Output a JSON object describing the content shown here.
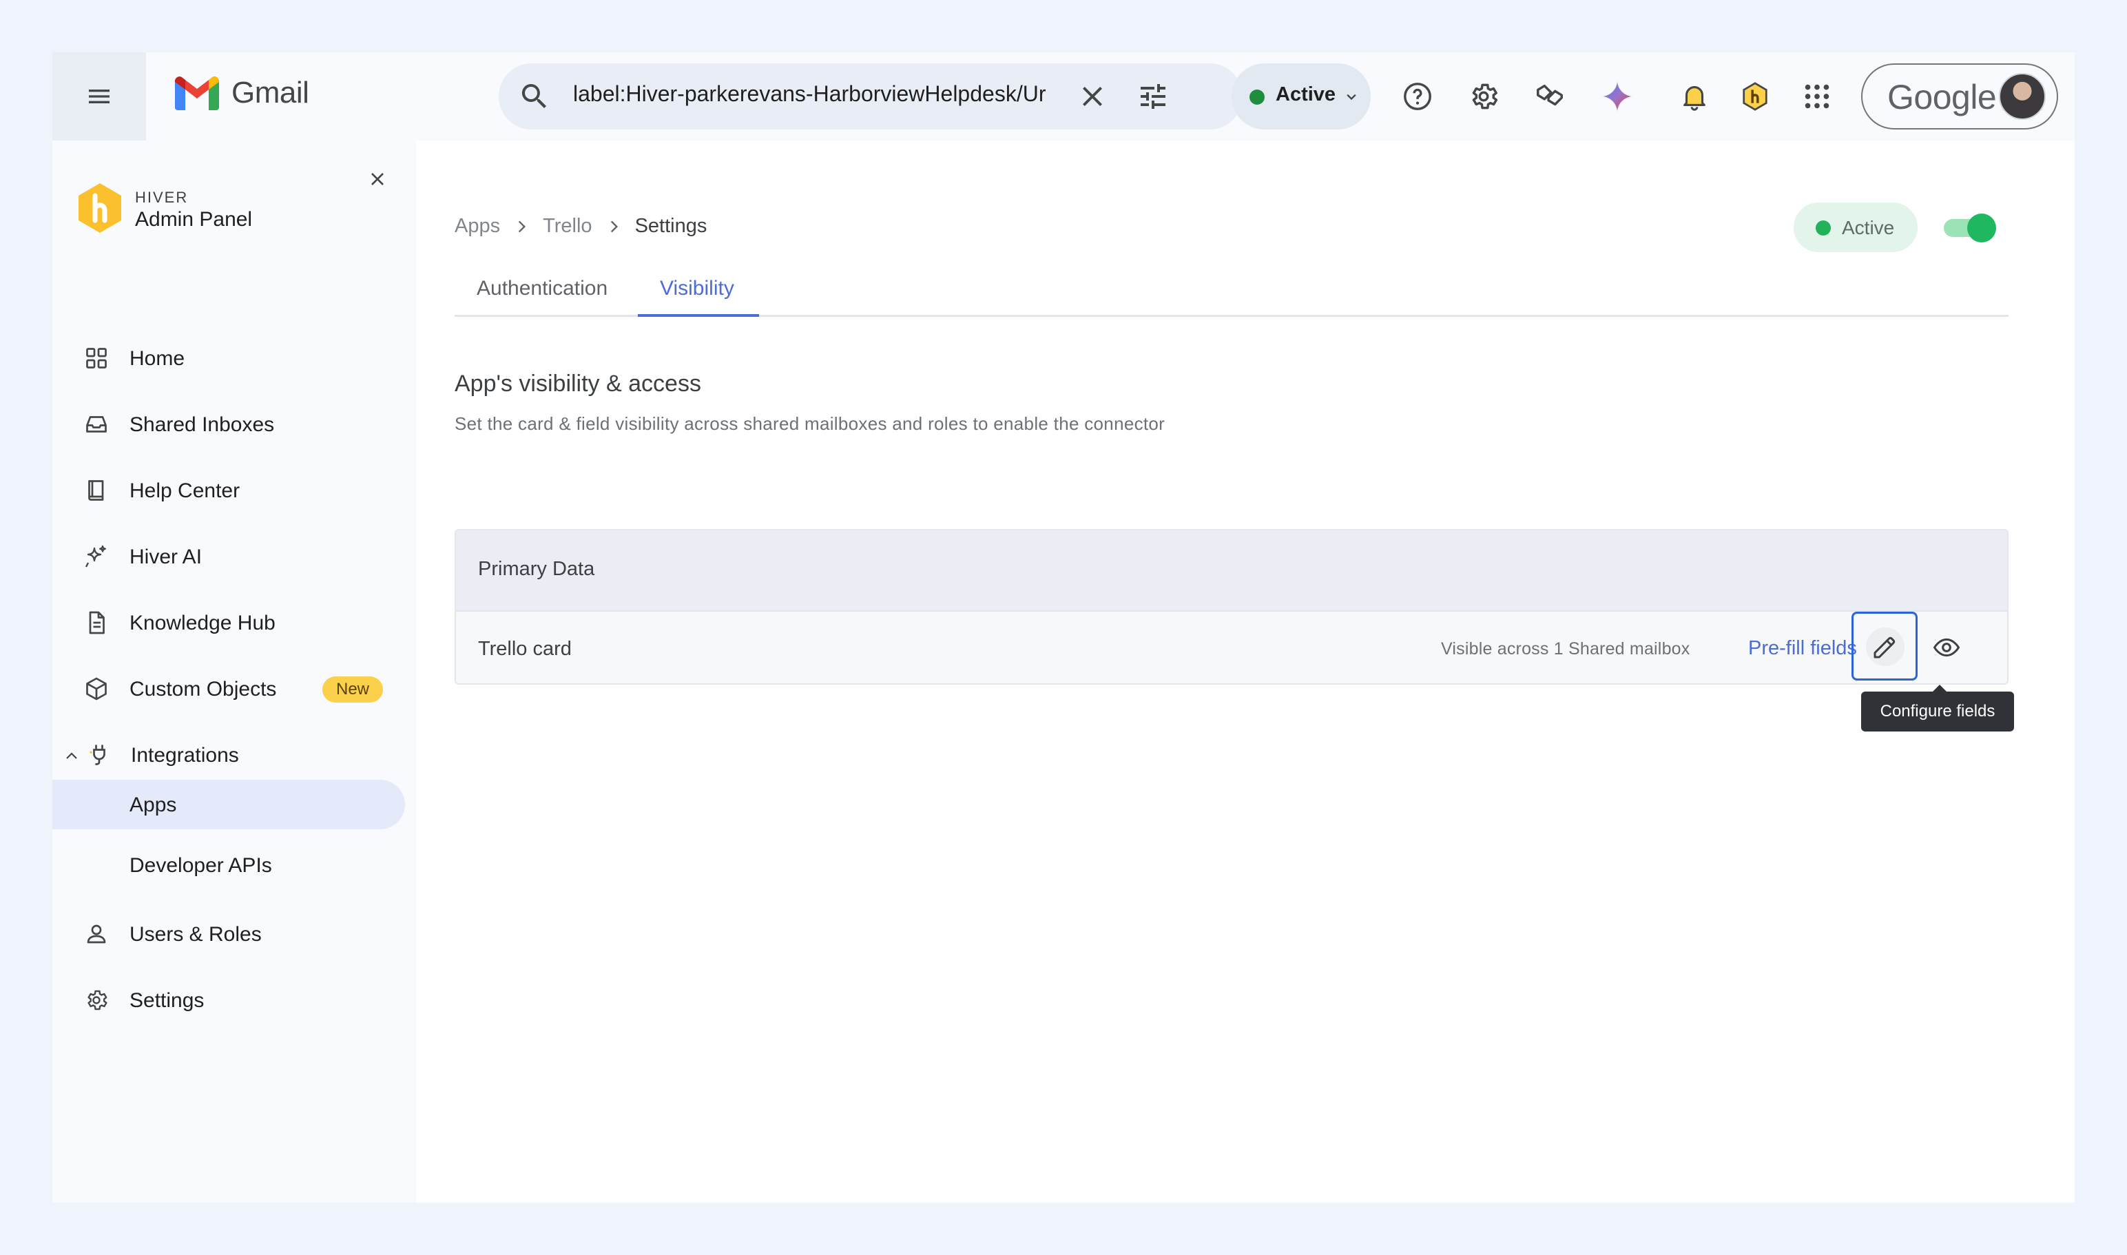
{
  "gmail": {
    "app_name": "Gmail",
    "search": {
      "query": "label:Hiver-parkerevans-HarborviewHelpdesk/Ur"
    },
    "status": {
      "label": "Active",
      "color": "#1e8e3e"
    },
    "account": {
      "brand": "Google"
    },
    "icons": [
      "menu-icon",
      "search-icon",
      "clear-icon",
      "search-options-icon",
      "help-icon",
      "settings-icon",
      "hiver-extension-icon",
      "gemini-icon",
      "notifications-icon",
      "hiver-badge-icon",
      "apps-grid-icon"
    ]
  },
  "sidebar": {
    "brand_small": "HIVER",
    "title": "Admin Panel",
    "items": [
      {
        "label": "Home",
        "icon": "grid-icon"
      },
      {
        "label": "Shared Inboxes",
        "icon": "inbox-icon"
      },
      {
        "label": "Help Center",
        "icon": "book-icon"
      },
      {
        "label": "Hiver AI",
        "icon": "sparkle-icon"
      },
      {
        "label": "Knowledge Hub",
        "icon": "document-icon"
      },
      {
        "label": "Custom Objects",
        "icon": "cube-icon",
        "badge": "New"
      },
      {
        "label": "Integrations",
        "icon": "plug-icon",
        "expanded": true
      },
      {
        "label": "Apps",
        "selected": true
      },
      {
        "label": "Developer APIs"
      },
      {
        "label": "Users & Roles",
        "icon": "user-icon"
      },
      {
        "label": "Settings",
        "icon": "gear-icon"
      }
    ]
  },
  "main": {
    "breadcrumb": [
      "Apps",
      "Trello",
      "Settings"
    ],
    "status_chip": "Active",
    "toggle_on": true,
    "tabs": [
      {
        "label": "Authentication",
        "active": false
      },
      {
        "label": "Visibility",
        "active": true
      }
    ],
    "section_title": "App's visibility & access",
    "section_desc": "Set the card & field visibility across shared mailboxes and roles to enable the connector",
    "card": {
      "header": "Primary Data",
      "row": {
        "name": "Trello card",
        "visibility": "Visible across 1 Shared mailbox",
        "prefill": "Pre-fill fields"
      }
    },
    "tooltip": "Configure fields"
  },
  "colors": {
    "accent": "#4c6cd6",
    "active_green": "#1fb860",
    "badge_yellow": "#fbd14b"
  }
}
